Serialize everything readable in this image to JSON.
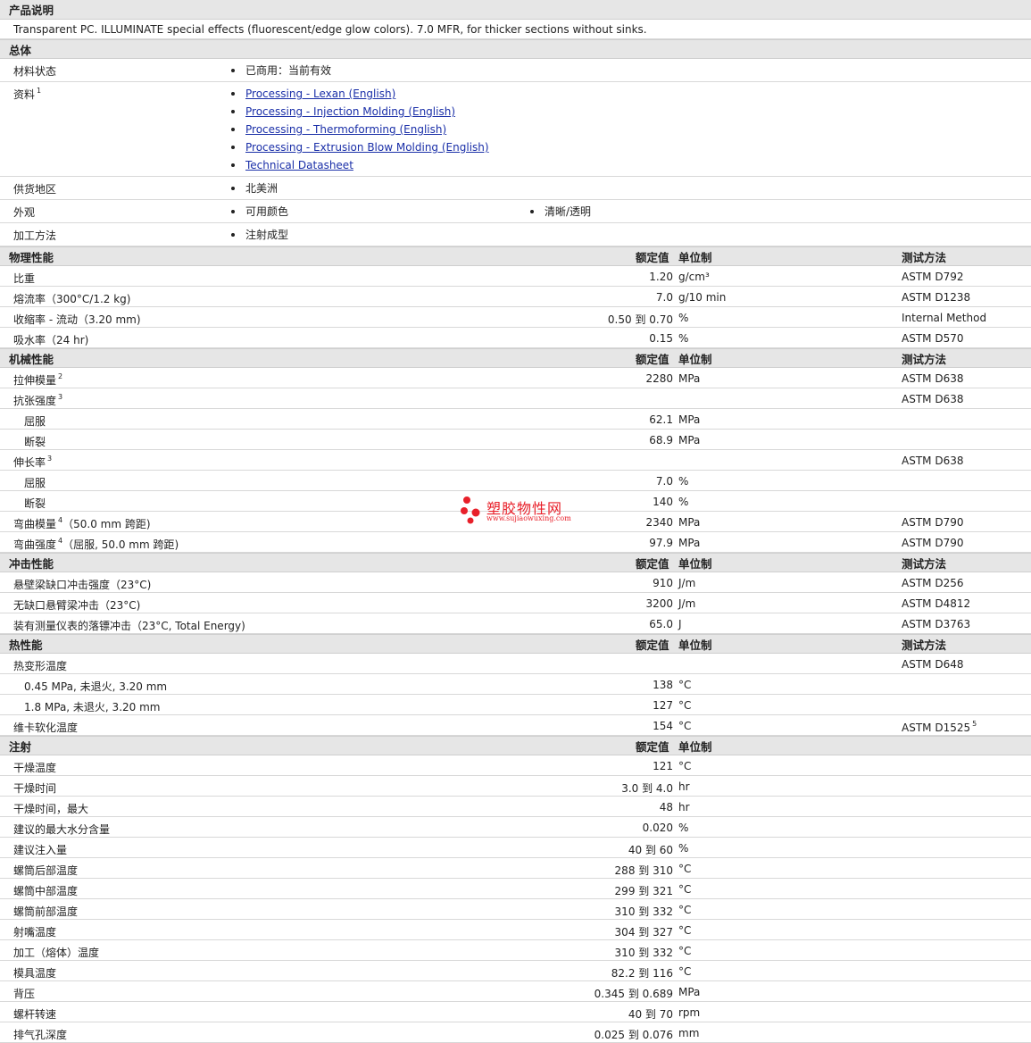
{
  "desc_section": {
    "title": "产品说明",
    "text": "Transparent PC. ILLUMINATE special effects (fluorescent/edge glow colors). 7.0 MFR, for thicker sections without sinks."
  },
  "general": {
    "title": "总体",
    "rows": [
      {
        "label": "材料状态",
        "items": [
          "已商用：当前有效"
        ]
      },
      {
        "label": "资料",
        "sup": "1",
        "links": [
          "Processing - Lexan (English)",
          "Processing - Injection Molding (English)",
          "Processing - Thermoforming (English)",
          "Processing - Extrusion Blow Molding (English)",
          "Technical Datasheet"
        ]
      },
      {
        "label": "供货地区",
        "items": [
          "北美洲"
        ]
      },
      {
        "label": "外观",
        "items": [
          "可用颜色",
          "清晰/透明"
        ]
      },
      {
        "label": "加工方法",
        "items": [
          "注射成型"
        ]
      }
    ]
  },
  "headers": {
    "nominal": "额定值",
    "unit": "单位制",
    "test": "测试方法"
  },
  "sections": [
    {
      "title": "物理性能",
      "has_test": true,
      "rows": [
        {
          "label": "比重",
          "val": "1.20",
          "unit": "g/cm³",
          "test": "ASTM D792"
        },
        {
          "label": "熔流率（300°C/1.2 kg)",
          "val": "7.0",
          "unit": "g/10 min",
          "test": "ASTM D1238"
        },
        {
          "label": "收缩率 - 流动（3.20 mm)",
          "val": "0.50 到  0.70",
          "unit": "%",
          "test": "Internal Method"
        },
        {
          "label": "吸水率（24 hr)",
          "val": "0.15",
          "unit": "%",
          "test": "ASTM D570"
        }
      ]
    },
    {
      "title": "机械性能",
      "has_test": true,
      "rows": [
        {
          "label": "拉伸模量",
          "sup": "2",
          "val": "2280",
          "unit": "MPa",
          "test": "ASTM D638"
        },
        {
          "label": "抗张强度",
          "sup": "3",
          "val": "",
          "unit": "",
          "test": "ASTM D638"
        },
        {
          "label": "屈服",
          "sub": true,
          "val": "62.1",
          "unit": "MPa",
          "test": ""
        },
        {
          "label": "断裂",
          "sub": true,
          "val": "68.9",
          "unit": "MPa",
          "test": ""
        },
        {
          "label": "伸长率",
          "sup": "3",
          "val": "",
          "unit": "",
          "test": "ASTM D638"
        },
        {
          "label": "屈服",
          "sub": true,
          "val": "7.0",
          "unit": "%",
          "test": ""
        },
        {
          "label": "断裂",
          "sub": true,
          "val": "140",
          "unit": "%",
          "test": ""
        },
        {
          "label": "弯曲模量",
          "sup": "4",
          "suffix": "（50.0 mm 跨距)",
          "val": "2340",
          "unit": "MPa",
          "test": "ASTM D790"
        },
        {
          "label": "弯曲强度",
          "sup": "4",
          "suffix": "（屈服, 50.0 mm 跨距)",
          "val": "97.9",
          "unit": "MPa",
          "test": "ASTM D790"
        }
      ]
    },
    {
      "title": "冲击性能",
      "has_test": true,
      "rows": [
        {
          "label": "悬壁梁缺口冲击强度（23°C)",
          "val": "910",
          "unit": "J/m",
          "test": "ASTM D256"
        },
        {
          "label": "无缺口悬臂梁冲击（23°C)",
          "val": "3200",
          "unit": "J/m",
          "test": "ASTM D4812"
        },
        {
          "label": "装有测量仪表的落镖冲击（23°C, Total Energy)",
          "val": "65.0",
          "unit": "J",
          "test": "ASTM D3763"
        }
      ]
    },
    {
      "title": "热性能",
      "has_test": true,
      "rows": [
        {
          "label": "热变形温度",
          "val": "",
          "unit": "",
          "test": "ASTM D648"
        },
        {
          "label": "0.45 MPa, 未退火, 3.20 mm",
          "sub": true,
          "val": "138",
          "unit": "°C",
          "test": ""
        },
        {
          "label": "1.8 MPa, 未退火, 3.20 mm",
          "sub": true,
          "val": "127",
          "unit": "°C",
          "test": ""
        },
        {
          "label": "维卡软化温度",
          "val": "154",
          "unit": "°C",
          "test": "ASTM D1525",
          "test_sup": "5"
        }
      ]
    },
    {
      "title": "注射",
      "has_test": false,
      "rows": [
        {
          "label": "干燥温度",
          "val": "121",
          "unit": "°C",
          "test": ""
        },
        {
          "label": "干燥时间",
          "val": "3.0 到  4.0",
          "unit": "hr",
          "test": ""
        },
        {
          "label": "干燥时间，最大",
          "val": "48",
          "unit": "hr",
          "test": ""
        },
        {
          "label": "建议的最大水分含量",
          "val": "0.020",
          "unit": "%",
          "test": ""
        },
        {
          "label": "建议注入量",
          "val": "40 到  60",
          "unit": "%",
          "test": ""
        },
        {
          "label": "螺筒后部温度",
          "val": "288 到  310",
          "unit": "°C",
          "test": ""
        },
        {
          "label": "螺筒中部温度",
          "val": "299 到  321",
          "unit": "°C",
          "test": ""
        },
        {
          "label": "螺筒前部温度",
          "val": "310 到  332",
          "unit": "°C",
          "test": ""
        },
        {
          "label": "射嘴温度",
          "val": "304 到  327",
          "unit": "°C",
          "test": ""
        },
        {
          "label": "加工（熔体）温度",
          "val": "310 到  332",
          "unit": "°C",
          "test": ""
        },
        {
          "label": "模具温度",
          "val": "82.2 到  116",
          "unit": "°C",
          "test": ""
        },
        {
          "label": "背压",
          "val": "0.345 到  0.689",
          "unit": "MPa",
          "test": ""
        },
        {
          "label": "螺杆转速",
          "val": "40 到  70",
          "unit": "rpm",
          "test": ""
        },
        {
          "label": "排气孔深度",
          "val": "0.025 到  0.076",
          "unit": "mm",
          "test": ""
        }
      ]
    }
  ],
  "watermark": {
    "name": "塑胶物性网",
    "url": "www.sujiaowuxing.com",
    "color": "#e8202a"
  }
}
